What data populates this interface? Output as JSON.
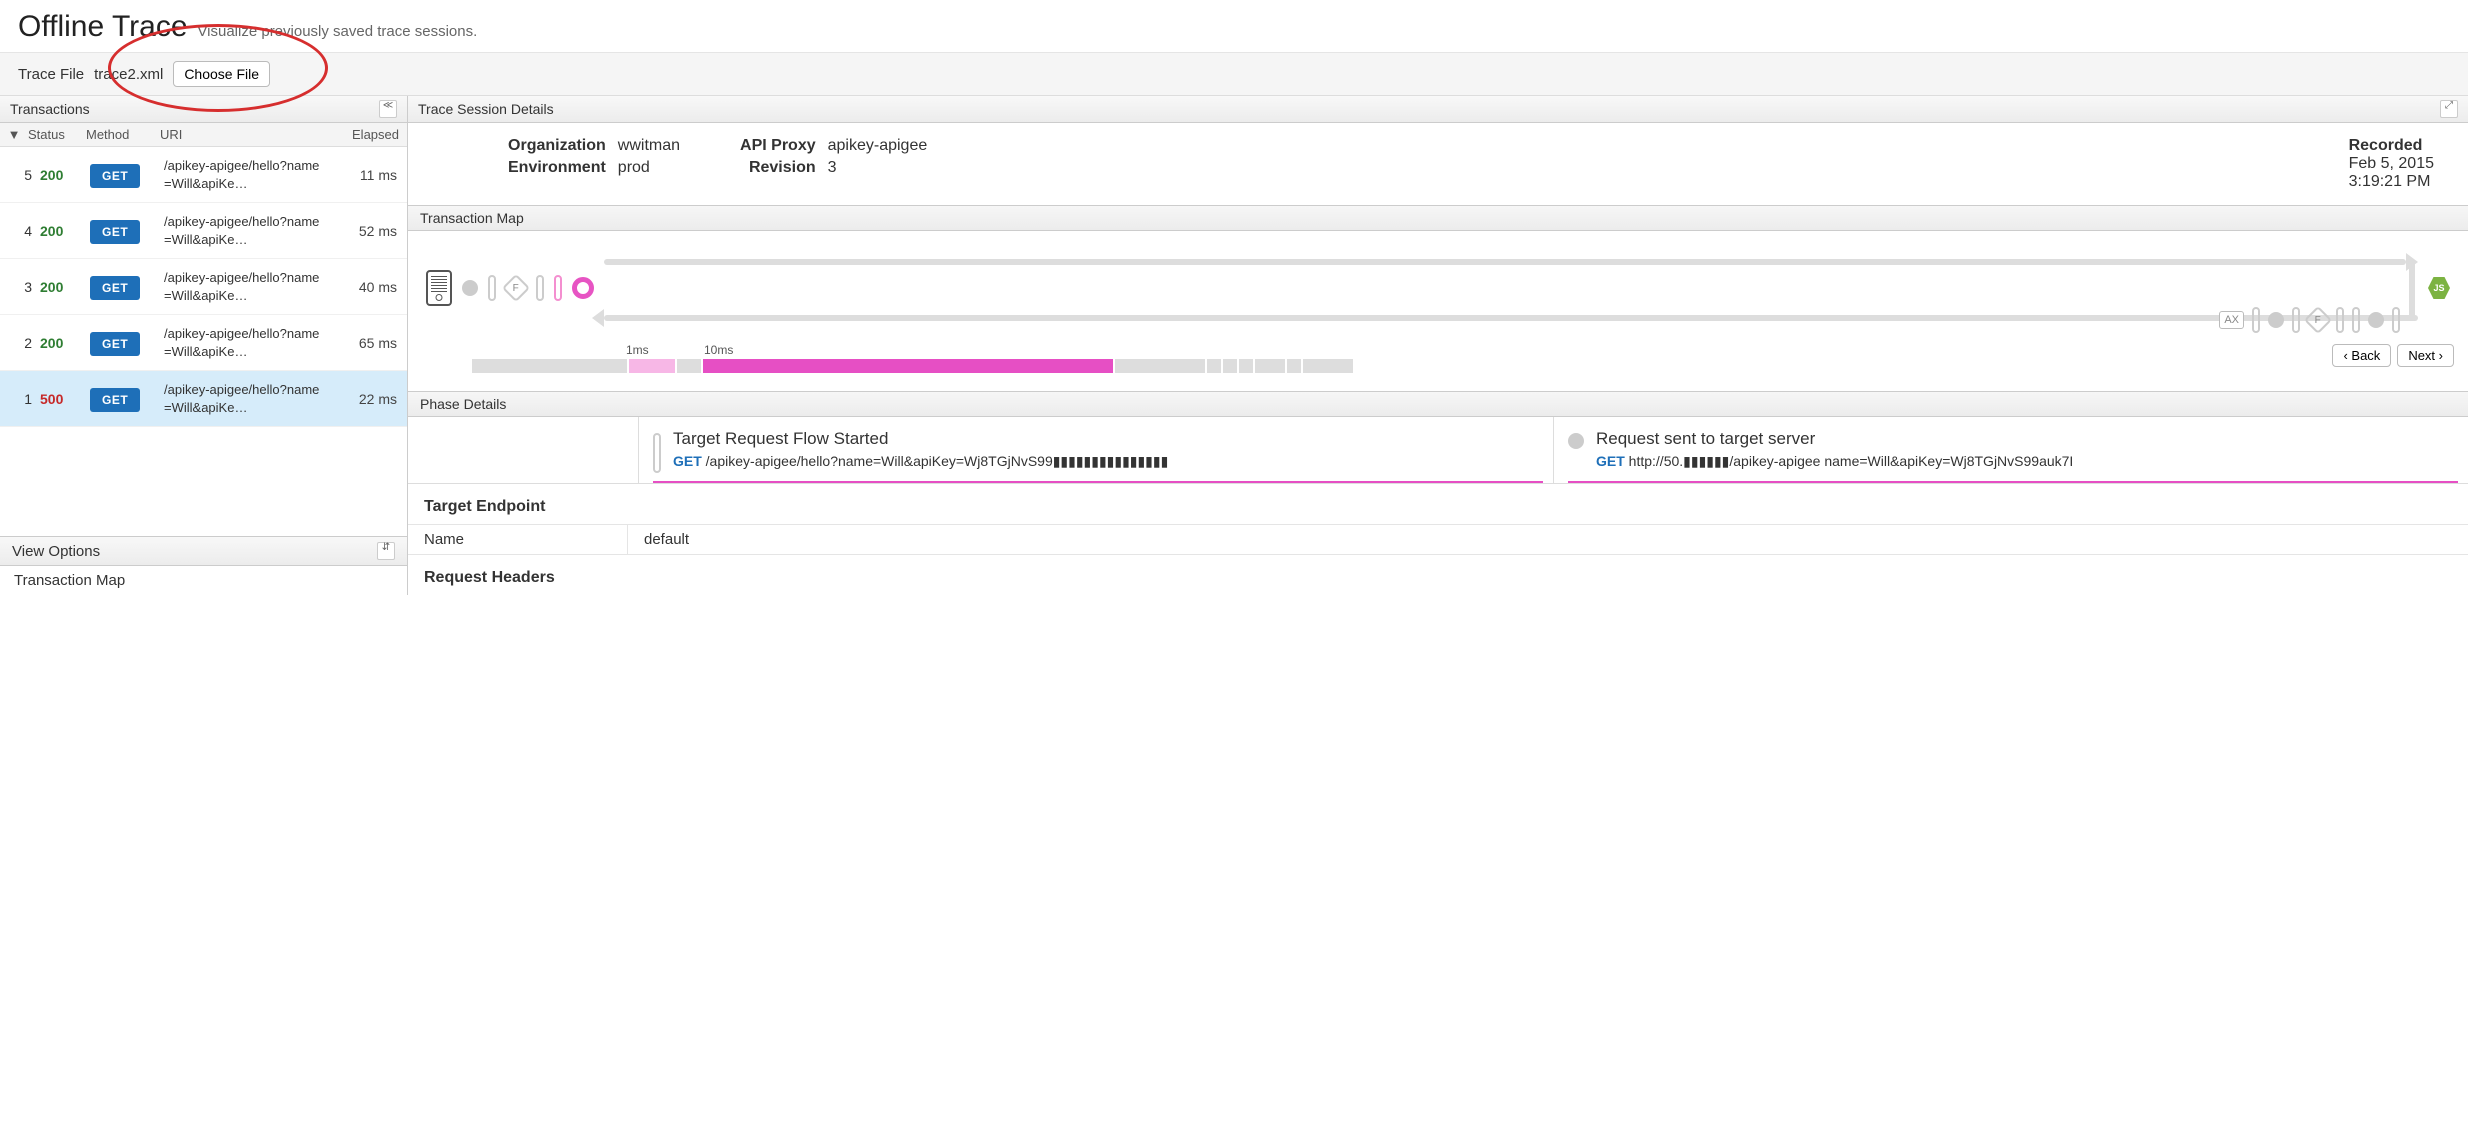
{
  "header": {
    "title": "Offline Trace",
    "subtitle": "Visualize previously saved trace sessions."
  },
  "traceFile": {
    "label": "Trace File",
    "filename": "trace2.xml",
    "choose_btn": "Choose File"
  },
  "transactions": {
    "panel_title": "Transactions",
    "collapse_glyph": "≪",
    "headers": {
      "status": "Status",
      "method": "Method",
      "uri": "URI",
      "elapsed": "Elapsed"
    },
    "rows": [
      {
        "num": "5",
        "status": "200",
        "status_class": "status-200",
        "method": "GET",
        "uri": "/apikey-apigee/hello?name=Will&apiKe…",
        "elapsed": "11 ms",
        "selected": false
      },
      {
        "num": "4",
        "status": "200",
        "status_class": "status-200",
        "method": "GET",
        "uri": "/apikey-apigee/hello?name=Will&apiKe…",
        "elapsed": "52 ms",
        "selected": false
      },
      {
        "num": "3",
        "status": "200",
        "status_class": "status-200",
        "method": "GET",
        "uri": "/apikey-apigee/hello?name=Will&apiKe…",
        "elapsed": "40 ms",
        "selected": false
      },
      {
        "num": "2",
        "status": "200",
        "status_class": "status-200",
        "method": "GET",
        "uri": "/apikey-apigee/hello?name=Will&apiKe…",
        "elapsed": "65 ms",
        "selected": false
      },
      {
        "num": "1",
        "status": "500",
        "status_class": "status-500",
        "method": "GET",
        "uri": "/apikey-apigee/hello?name=Will&apiKe…",
        "elapsed": "22 ms",
        "selected": true
      }
    ]
  },
  "viewOptions": {
    "title": "View Options",
    "items": [
      "Transaction Map"
    ]
  },
  "session": {
    "panel_title": "Trace Session Details",
    "org_label": "Organization",
    "org_val": "wwitman",
    "env_label": "Environment",
    "env_val": "prod",
    "proxy_label": "API Proxy",
    "proxy_val": "apikey-apigee",
    "rev_label": "Revision",
    "rev_val": "3",
    "recorded_label": "Recorded",
    "recorded_date": "Feb 5, 2015",
    "recorded_time": "3:19:21 PM"
  },
  "tmap": {
    "title": "Transaction Map",
    "time1": "1ms",
    "time2": "10ms",
    "back_btn": "Back",
    "next_btn": "Next",
    "ax_label": "AX",
    "f_label": "F",
    "js_label": "JS"
  },
  "phase": {
    "title": "Phase Details",
    "left_title": "Target Request Flow Started",
    "left_method": "GET",
    "left_url": "/apikey-apigee/hello?name=Will&apiKey=Wj8TGjNvS99▮▮▮▮▮▮▮▮▮▮▮▮▮▮▮",
    "right_title": "Request sent to target server",
    "right_method": "GET",
    "right_url": "http://50.▮▮▮▮▮▮/apikey-apigee name=Will&apiKey=Wj8TGjNvS99auk7I"
  },
  "details": {
    "endpoint_title": "Target Endpoint",
    "name_key": "Name",
    "name_val": "default",
    "req_headers_title": "Request Headers"
  }
}
